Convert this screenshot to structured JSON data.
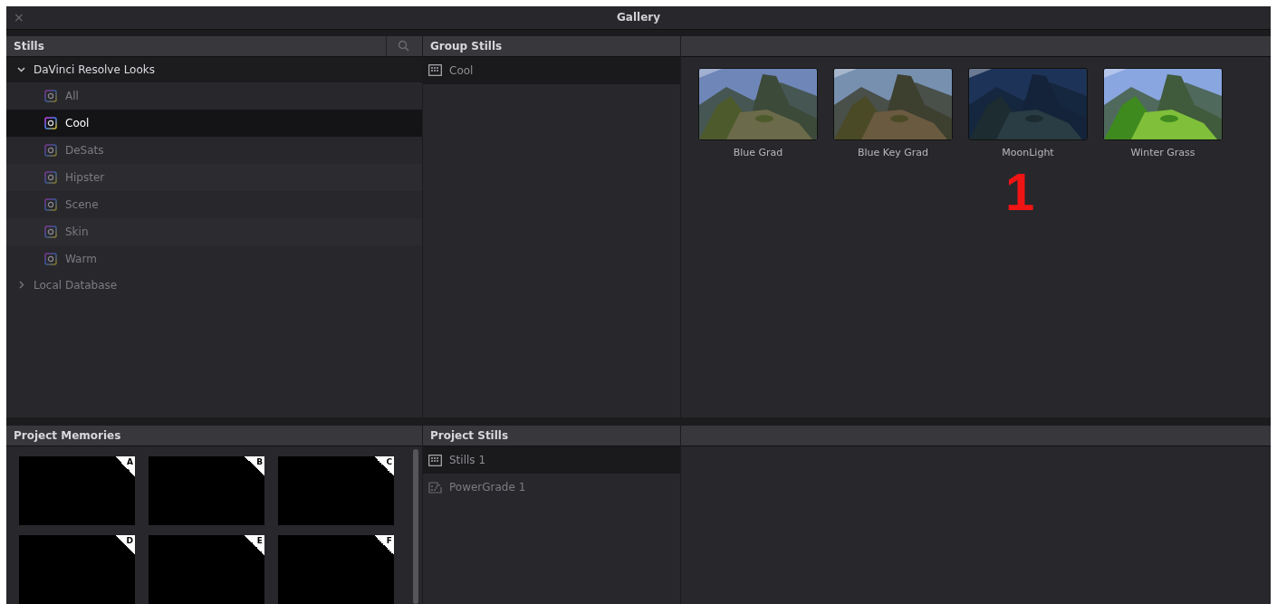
{
  "window": {
    "close": "×",
    "title": "Gallery"
  },
  "stills": {
    "title": "Stills",
    "tree": [
      {
        "label": "DaVinci Resolve Looks",
        "expanded": true,
        "children": [
          {
            "label": "All",
            "selected": false
          },
          {
            "label": "Cool",
            "selected": true
          },
          {
            "label": "DeSats",
            "selected": false
          },
          {
            "label": "Hipster",
            "selected": false
          },
          {
            "label": "Scene",
            "selected": false
          },
          {
            "label": "Skin",
            "selected": false
          },
          {
            "label": "Warm",
            "selected": false
          }
        ]
      },
      {
        "label": "Local Database",
        "expanded": false
      }
    ]
  },
  "group_stills": {
    "title": "Group Stills",
    "items": [
      {
        "label": "Cool",
        "selected": true
      }
    ]
  },
  "gallery": {
    "stills": [
      {
        "label": "Blue Grad",
        "kind": "picture"
      },
      {
        "label": "Blue Key Grad",
        "kind": "picture"
      },
      {
        "label": "MoonLight",
        "kind": "picture"
      },
      {
        "label": "Winter Grass",
        "kind": "picture"
      }
    ],
    "annotation": "1"
  },
  "project_memories": {
    "title": "Project Memories",
    "memories": [
      "A",
      "B",
      "C",
      "D",
      "E",
      "F"
    ]
  },
  "project_stills": {
    "title": "Project Stills",
    "items": [
      {
        "label": "Stills 1",
        "kind": "album",
        "selected": true
      },
      {
        "label": "PowerGrade 1",
        "kind": "powergrade",
        "selected": false
      }
    ]
  }
}
